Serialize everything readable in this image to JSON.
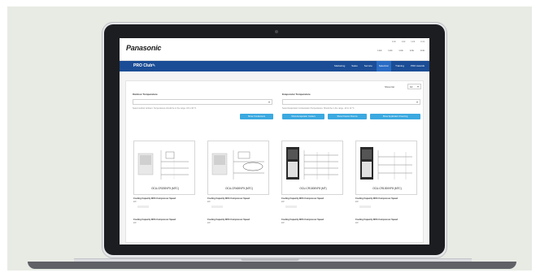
{
  "header": {
    "logo": "Panasonic",
    "top_links": [
      "Link",
      "Link",
      "Link",
      "Link"
    ],
    "util_links": [
      "Link",
      "Link",
      "Link",
      "Link",
      "Link"
    ]
  },
  "nav": {
    "brand": "PRO Club",
    "items": [
      {
        "label": "Marketing",
        "active": false
      },
      {
        "label": "Sales",
        "active": false
      },
      {
        "label": "Service",
        "active": false
      },
      {
        "label": "Selection",
        "active": true
      },
      {
        "label": "Training",
        "active": false
      },
      {
        "label": "PRO Awards",
        "active": false
      }
    ]
  },
  "filters": {
    "outdoor_label": "Outdoor Temperature",
    "indoor_label": "Evaporator Temperature",
    "outdoor_note": "Select outdoor ambient. Temperatures should be in the range -15 to 46 °C",
    "indoor_note": "Select Evaporator Condensation Temperatures. Should be in the range -10 to 10 °C",
    "show_label": "Show list",
    "show_value": "10"
  },
  "buttons": [
    "Show Condensers",
    "Show Evaporator Coolers",
    "Show Freezer Rooms",
    "Show Application Freezing"
  ],
  "products": [
    {
      "model": "OCU-CR200VF5 (MTC)"
    },
    {
      "model": "OCU-CR400VF5 (MTC)"
    },
    {
      "model": "OCU-CR1000VF8 (MT)"
    },
    {
      "model": "OCU-CR1000VF8 (MTC)"
    }
  ],
  "specs": {
    "row1_label": "Cooling Capacity With Compressor Speed",
    "row1_unit": "kW",
    "row2_label": "Cooling Capacity With Compressor Speed",
    "row2_unit": "kW"
  },
  "colors": {
    "nav": "#1b4d96",
    "nav_active": "#2a6cc4",
    "button": "#3ba9e0",
    "background": "#e7ebe4"
  }
}
